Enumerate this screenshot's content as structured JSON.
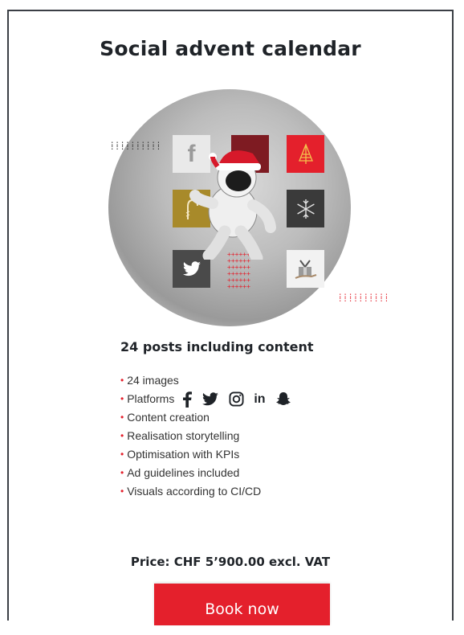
{
  "card": {
    "title": "Social advent calendar",
    "subtitle": "24 posts including content",
    "features": [
      "24 images",
      "Platforms",
      "Content creation",
      "Realisation storytelling",
      "Optimisation with KPIs",
      "Ad guidelines included",
      "Visuals according to CI/CD"
    ],
    "bullet": "•",
    "platforms": [
      "facebook-icon",
      "twitter-icon",
      "instagram-icon",
      "linkedin-icon",
      "snapchat-icon"
    ],
    "linkedin_text": "in",
    "price": "Price: CHF 5’900.00 excl. VAT",
    "button_label": "Book now"
  },
  "hero": {
    "tiles": [
      "facebook-tile",
      "red-tile",
      "tree-tile",
      "candy-tile",
      "snowflake-tile",
      "twitter-tile",
      "gift-tile"
    ],
    "facebook_letter": "f"
  },
  "colors": {
    "accent": "#e4202c",
    "dark_red": "#8b1a22",
    "gold": "#a88a2a",
    "text": "#1f2328",
    "border": "#3b3f45"
  }
}
